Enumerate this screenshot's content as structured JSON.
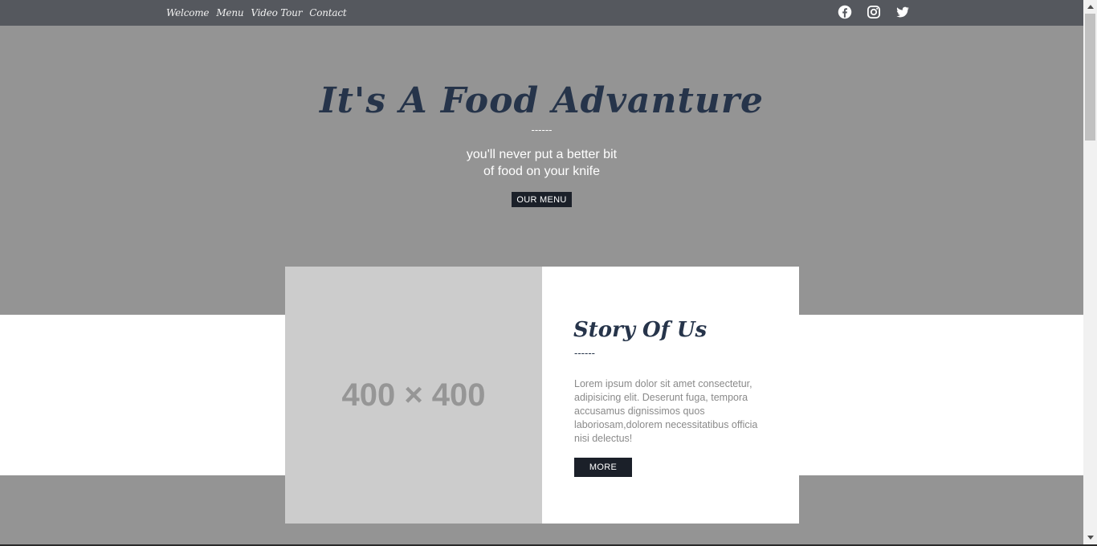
{
  "nav": {
    "links": [
      "Welcome",
      "Menu",
      "Video Tour",
      "Contact"
    ],
    "social_icons": [
      "facebook-icon",
      "instagram-icon",
      "twitter-icon"
    ]
  },
  "hero": {
    "title": "It's A Food Advanture",
    "divider": "------",
    "subtitle_line1": "you'll never put a better bit",
    "subtitle_line2": "of food on your knife",
    "button_label": "OUR MENU"
  },
  "story": {
    "image_placeholder": "400 × 400",
    "title": "Story Of Us",
    "divider": "------",
    "text": "Lorem ipsum dolor sit amet consectetur, adipisicing elit. Deserunt fuga, tempora accusamus dignissimos quos laboriosam,dolorem necessitatibus officia nisi delectus!",
    "button_label": "MORE"
  },
  "colors": {
    "navbar_bg": "#55585e",
    "hero_bg": "#949494",
    "title_color": "#26344a",
    "button_bg": "#1b2029"
  }
}
